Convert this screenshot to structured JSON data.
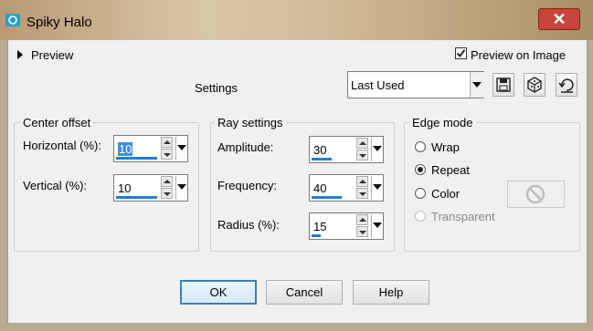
{
  "window": {
    "title": "Spiky Halo",
    "close_glyph": "✕"
  },
  "preview": {
    "toggle_label": "Preview",
    "checkbox_label": "Preview on Image",
    "checkbox_checked": true
  },
  "settings": {
    "label": "Settings",
    "preset_value": "Last Used"
  },
  "center_offset": {
    "title": "Center offset",
    "horizontal_label": "Horizontal (%):",
    "horizontal_value": "10",
    "vertical_label": "Vertical (%):",
    "vertical_value": "10"
  },
  "ray_settings": {
    "title": "Ray settings",
    "amplitude_label": "Amplitude:",
    "amplitude_value": "30",
    "frequency_label": "Frequency:",
    "frequency_value": "40",
    "radius_label": "Radius (%):",
    "radius_value": "15"
  },
  "edge_mode": {
    "title": "Edge mode",
    "options": [
      {
        "label": "Wrap",
        "selected": false,
        "enabled": true
      },
      {
        "label": "Repeat",
        "selected": true,
        "enabled": true
      },
      {
        "label": "Color",
        "selected": false,
        "enabled": true
      },
      {
        "label": "Transparent",
        "selected": false,
        "enabled": false
      }
    ]
  },
  "buttons": {
    "ok": "OK",
    "cancel": "Cancel",
    "help": "Help"
  },
  "icons": {
    "app": "halo-app-icon",
    "save_preset": "save-icon",
    "randomize": "dice-icon",
    "reset": "reset-icon",
    "color_swatch": "no-color-icon"
  },
  "colors": {
    "accent_bar": "#1c7fd8",
    "close_button": "#c7453a",
    "default_button_border": "#3c7fb1"
  }
}
